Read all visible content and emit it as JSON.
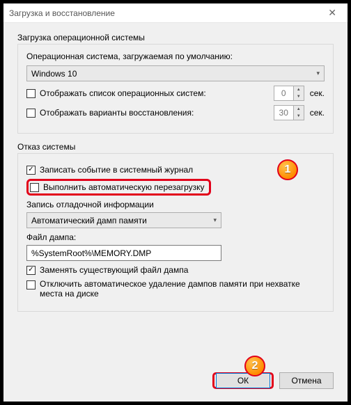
{
  "window": {
    "title": "Загрузка и восстановление"
  },
  "startup": {
    "group_label": "Загрузка операционной системы",
    "default_os_label": "Операционная система, загружаемая по умолчанию:",
    "default_os_value": "Windows 10",
    "show_list_label": "Отображать список операционных систем:",
    "show_list_seconds": "0",
    "show_recovery_label": "Отображать варианты восстановления:",
    "show_recovery_seconds": "30",
    "seconds_unit": "сек."
  },
  "failure": {
    "group_label": "Отказ системы",
    "log_event_label": "Записать событие в системный журнал",
    "auto_restart_label": "Выполнить автоматическую перезагрузку",
    "debug_info_label": "Запись отладочной информации",
    "dump_type": "Автоматический дамп памяти",
    "dump_file_label": "Файл дампа:",
    "dump_file_value": "%SystemRoot%\\MEMORY.DMP",
    "overwrite_label": "Заменять существующий файл дампа",
    "disable_auto_delete_label": "Отключить автоматическое удаление дампов памяти при нехватке места на диске"
  },
  "buttons": {
    "ok": "ОК",
    "cancel": "Отмена"
  },
  "callouts": {
    "one": "1",
    "two": "2"
  }
}
